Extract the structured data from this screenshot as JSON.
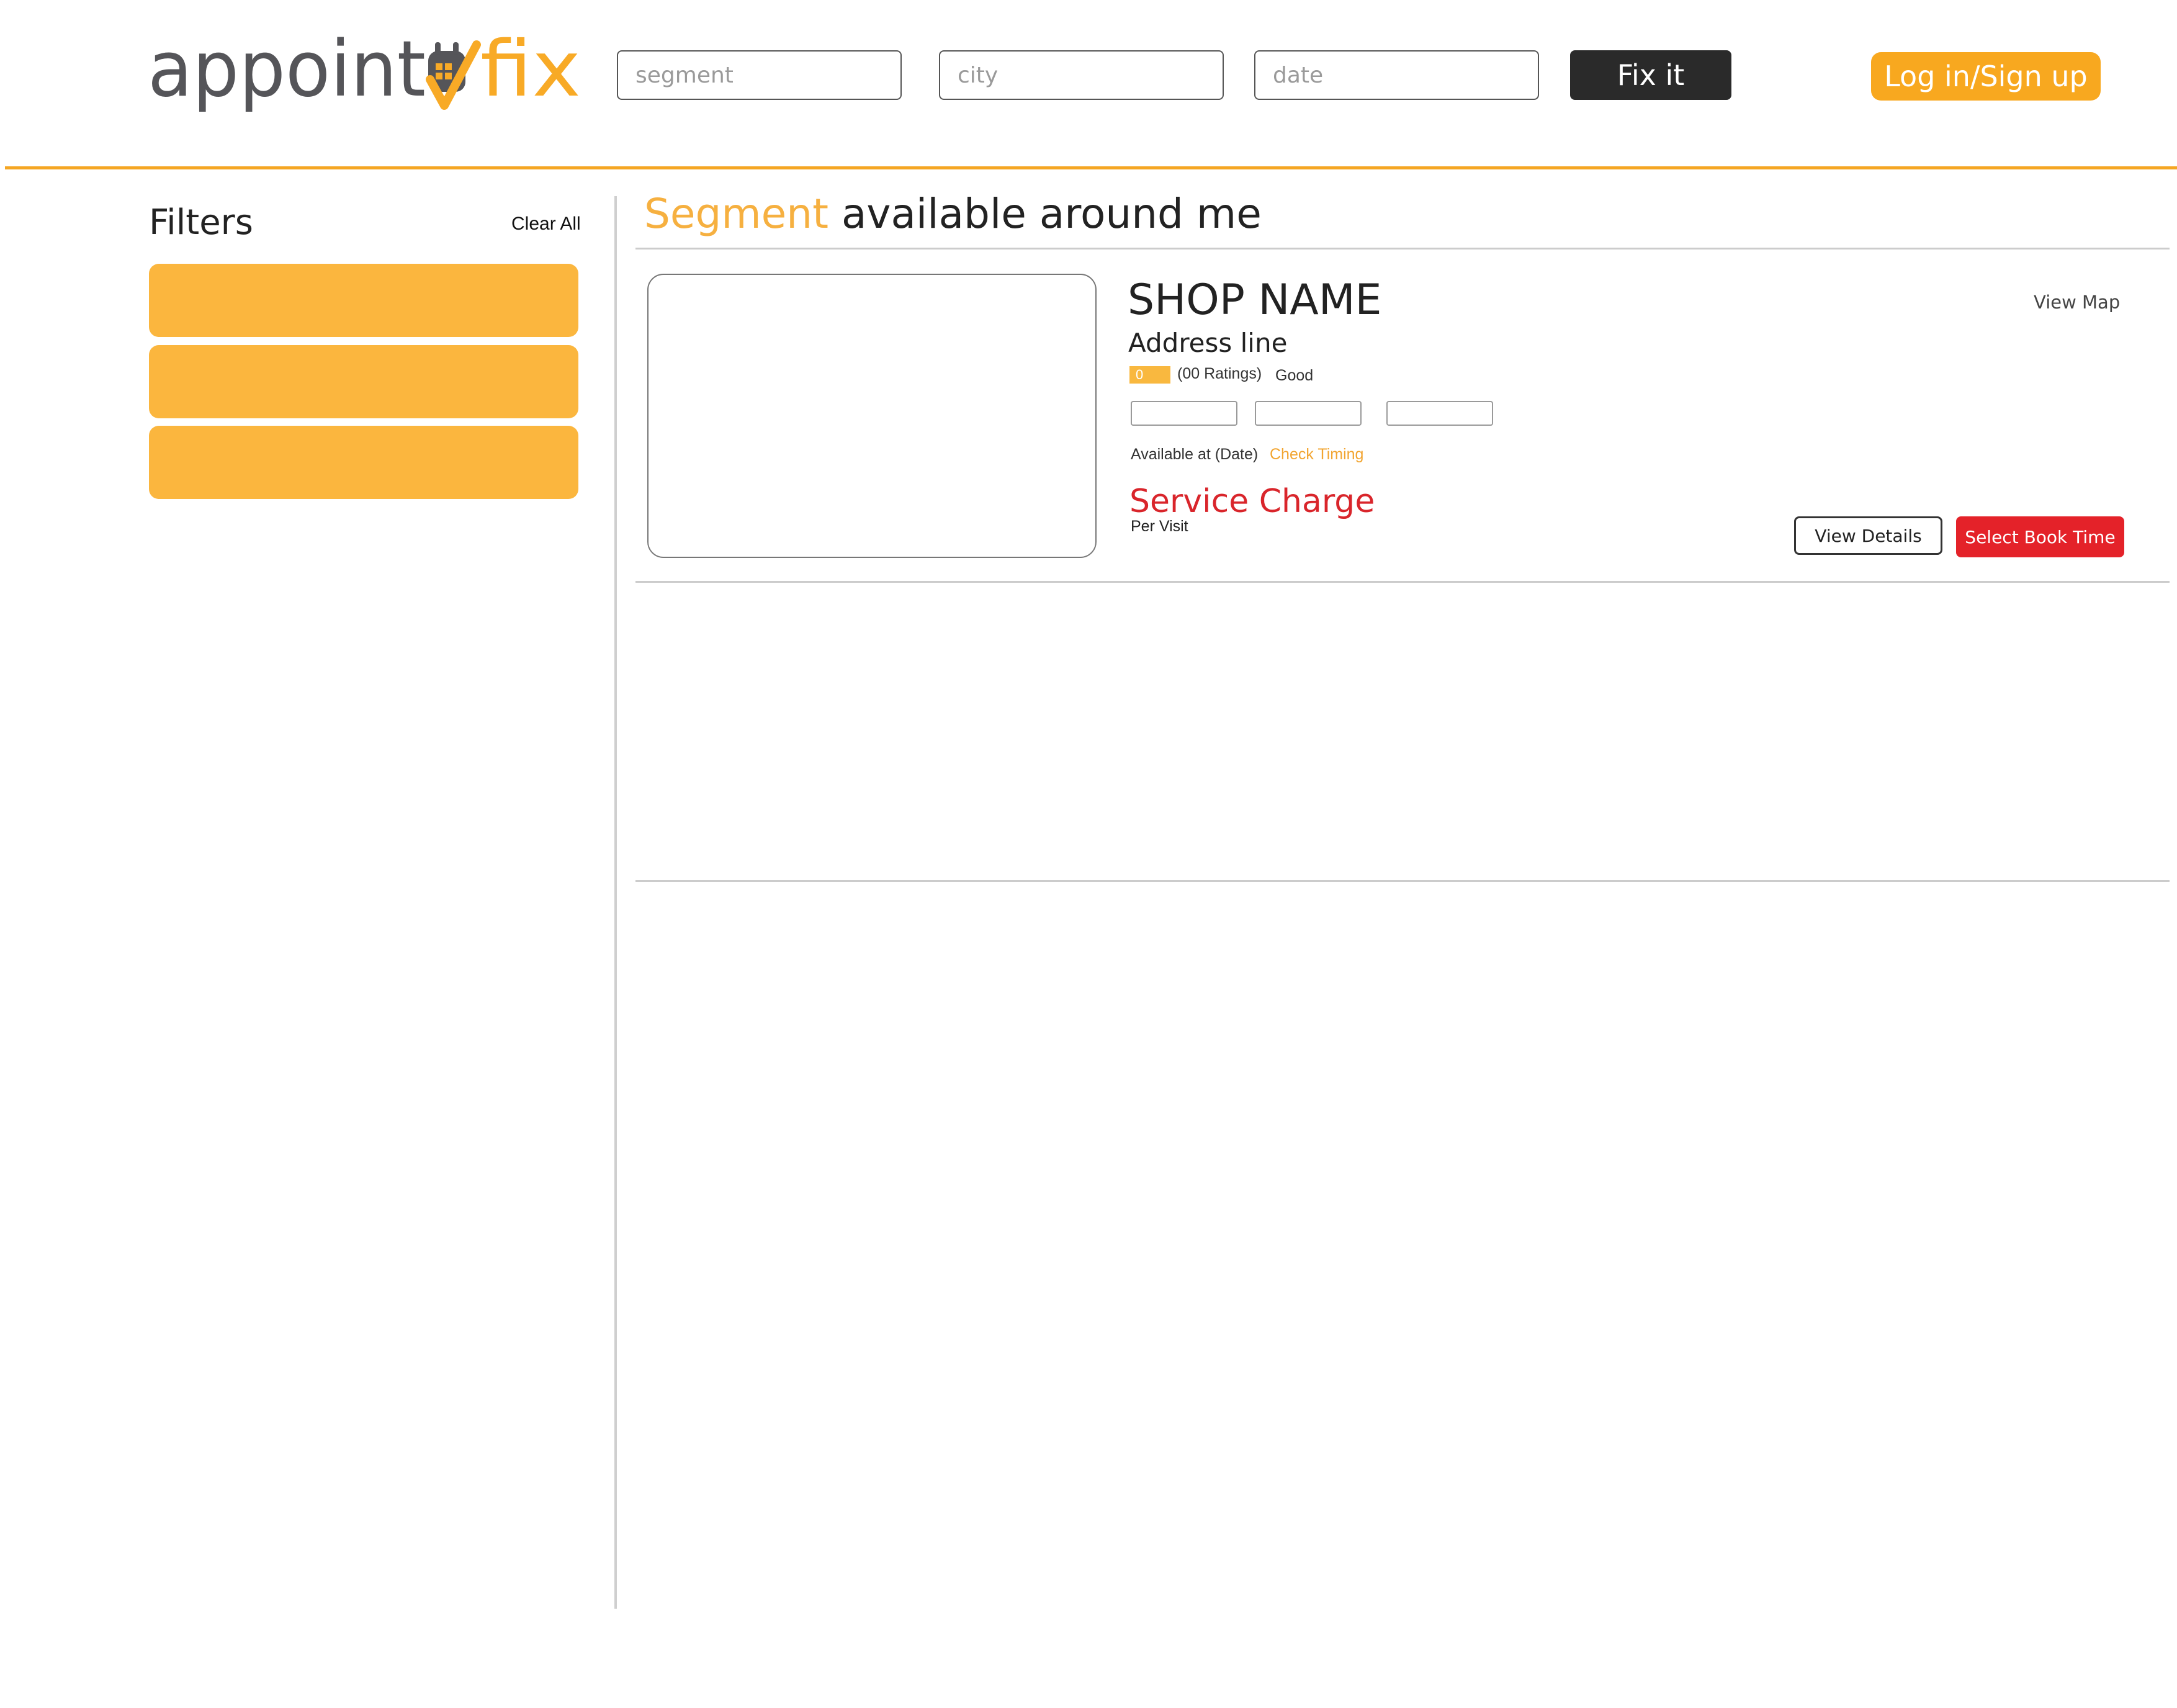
{
  "brand": {
    "logo_text_dark": "appoint",
    "logo_text_accent": "fix",
    "logo_icon": "calendar-checkmark-icon",
    "colors": {
      "dark": "#555559",
      "accent": "#f8aa26"
    }
  },
  "search": {
    "segment_placeholder": "segment",
    "city_placeholder": "city",
    "date_placeholder": "date",
    "submit_label": "Fix it"
  },
  "auth": {
    "login_label": "Log in/Sign up"
  },
  "sidebar": {
    "title": "Filters",
    "clear_all_label": "Clear All",
    "filters": [
      {
        "label": ""
      },
      {
        "label": ""
      },
      {
        "label": ""
      }
    ]
  },
  "results": {
    "heading_accent": "Segment",
    "heading_rest": " available around me"
  },
  "shop": {
    "name": "SHOP NAME",
    "address": "Address line",
    "rating_value": "0",
    "rating_count": "(00 Ratings)",
    "rating_label": "Good",
    "view_map_label": "View Map",
    "time_slots": [
      "",
      "",
      ""
    ],
    "available_text": "Available at (Date)",
    "check_timing_label": "Check Timing",
    "service_charge": "Service Charge",
    "per_visit": "Per Visit",
    "view_details_label": "View Details",
    "book_label": "Select Book Time"
  },
  "colors": {
    "accent_orange": "#f5a623",
    "filter_block": "#fbb63e",
    "cta_red": "#e42229",
    "dark_button": "#2a2a2a"
  }
}
